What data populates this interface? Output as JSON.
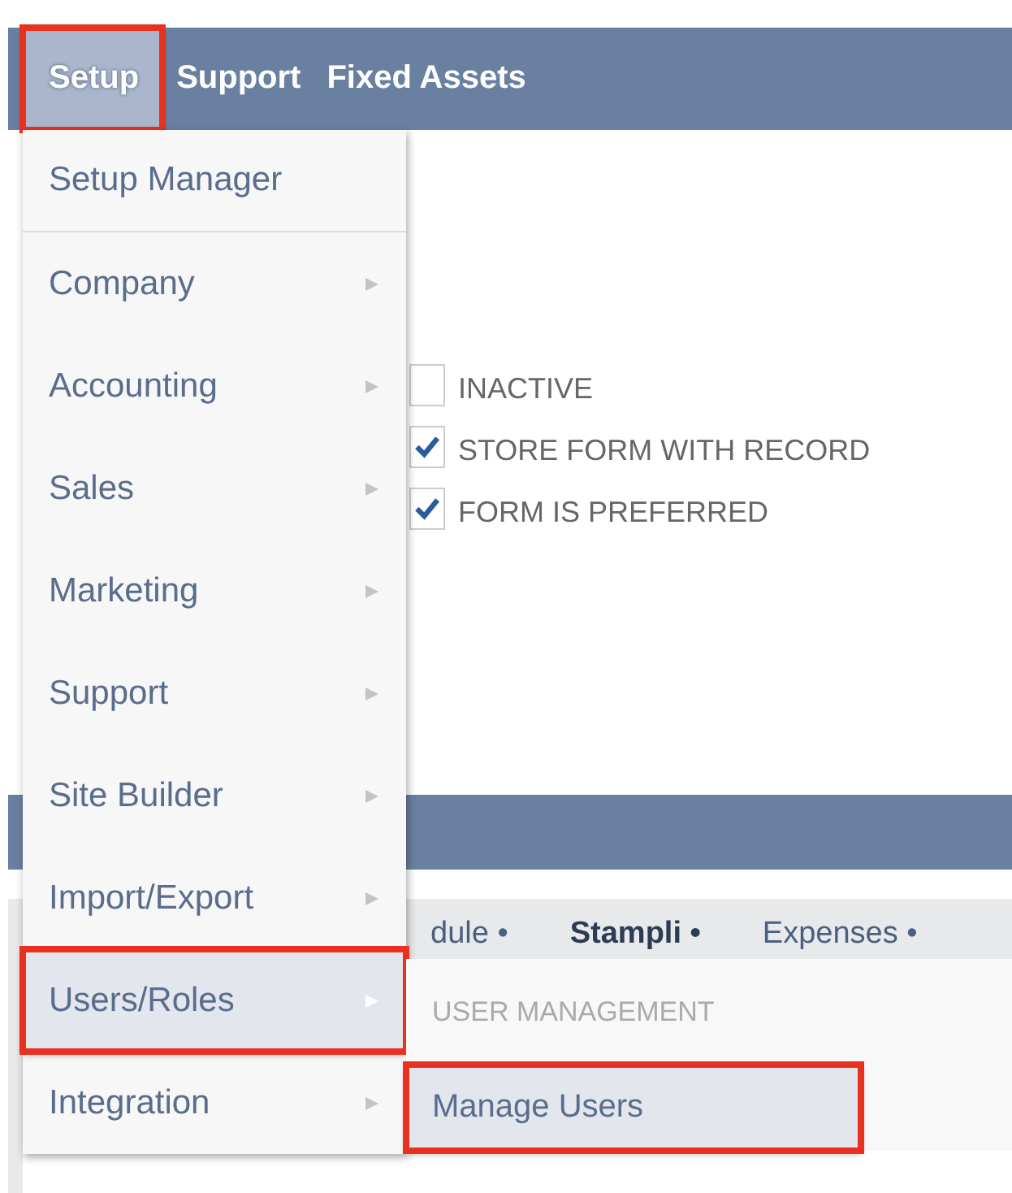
{
  "nav": {
    "items": [
      {
        "label": "Setup",
        "selected": true,
        "highlighted": true
      },
      {
        "label": "Support",
        "selected": false,
        "highlighted": false
      },
      {
        "label": "Fixed Assets",
        "selected": false,
        "highlighted": false
      }
    ]
  },
  "form_options": [
    {
      "label": "INACTIVE",
      "checked": false
    },
    {
      "label": "STORE FORM WITH RECORD",
      "checked": true
    },
    {
      "label": "FORM IS PREFERRED",
      "checked": true
    }
  ],
  "subtabs": [
    {
      "label": "dule •",
      "selected": false
    },
    {
      "label": "Stampli •",
      "selected": true
    },
    {
      "label": "Expenses •",
      "selected": false
    }
  ],
  "setup_menu": {
    "items": [
      {
        "label": "Setup Manager",
        "has_submenu": false,
        "hovered": false,
        "highlighted": false
      },
      {
        "label": "Company",
        "has_submenu": true,
        "hovered": false,
        "highlighted": false
      },
      {
        "label": "Accounting",
        "has_submenu": true,
        "hovered": false,
        "highlighted": false
      },
      {
        "label": "Sales",
        "has_submenu": true,
        "hovered": false,
        "highlighted": false
      },
      {
        "label": "Marketing",
        "has_submenu": true,
        "hovered": false,
        "highlighted": false
      },
      {
        "label": "Support",
        "has_submenu": true,
        "hovered": false,
        "highlighted": false
      },
      {
        "label": "Site Builder",
        "has_submenu": true,
        "hovered": false,
        "highlighted": false
      },
      {
        "label": "Import/Export",
        "has_submenu": true,
        "hovered": false,
        "highlighted": false
      },
      {
        "label": "Users/Roles",
        "has_submenu": true,
        "hovered": true,
        "highlighted": true
      },
      {
        "label": "Integration",
        "has_submenu": true,
        "hovered": false,
        "highlighted": false
      }
    ]
  },
  "submenu": {
    "header": "USER MANAGEMENT",
    "items": [
      {
        "label": "Manage Users",
        "hovered": true,
        "highlighted": true
      }
    ]
  }
}
